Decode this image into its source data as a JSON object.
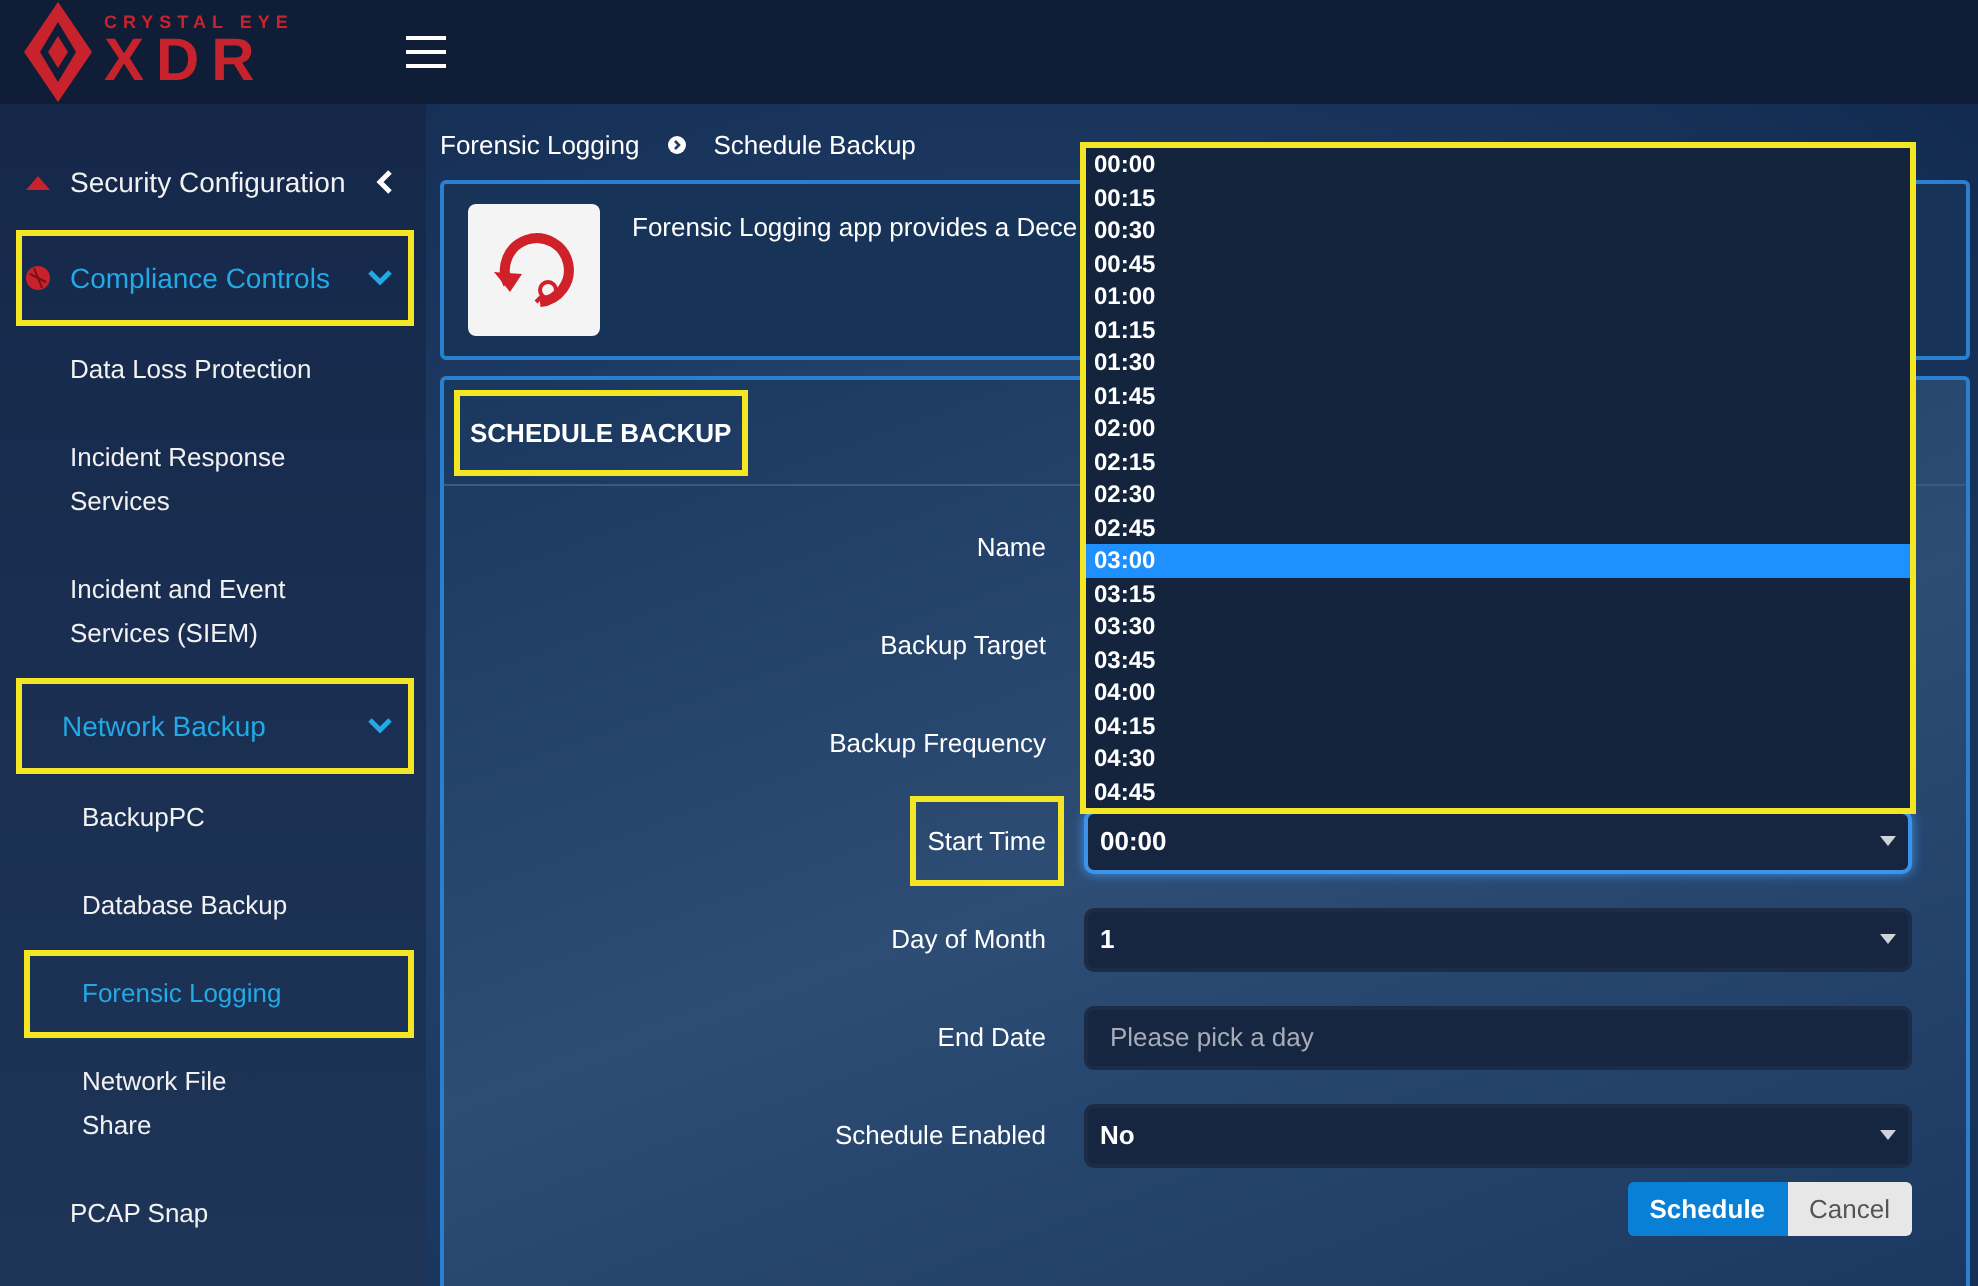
{
  "header": {
    "logo_tagline": "CRYSTAL EYE",
    "logo_text": "XDR"
  },
  "sidebar": {
    "items": [
      {
        "label": "Security Configuration",
        "kind": "section",
        "expanded": false,
        "selected": false,
        "highlighted": false
      },
      {
        "label": "Compliance Controls",
        "kind": "section",
        "expanded": true,
        "selected": true,
        "highlighted": true,
        "children": [
          {
            "label": "Data Loss Protection",
            "selected": false,
            "highlighted": false
          },
          {
            "label": "Incident Response\nServices",
            "selected": false,
            "highlighted": false
          },
          {
            "label": "Incident and Event\nServices (SIEM)",
            "selected": false,
            "highlighted": false
          },
          {
            "label": "Network Backup",
            "expanded": true,
            "selected": true,
            "highlighted": true,
            "children": [
              {
                "label": "BackupPC",
                "selected": false,
                "highlighted": false
              },
              {
                "label": "Database Backup",
                "selected": false,
                "highlighted": false
              },
              {
                "label": "Forensic Logging",
                "selected": true,
                "highlighted": true
              },
              {
                "label": "Network File\nShare",
                "selected": false,
                "highlighted": false
              }
            ]
          },
          {
            "label": "PCAP Snap",
            "selected": false,
            "highlighted": false
          }
        ]
      }
    ]
  },
  "breadcrumb": [
    "Forensic Logging",
    "Schedule Backup"
  ],
  "intro": {
    "text": "Forensic Logging app provides a Dece"
  },
  "form": {
    "title": "SCHEDULE BACKUP",
    "title_highlighted": true,
    "fields": [
      {
        "label": "Name",
        "kind": "covered",
        "highlighted": false
      },
      {
        "label": "Backup Target",
        "kind": "covered",
        "highlighted": false
      },
      {
        "label": "Backup Frequency",
        "kind": "covered",
        "highlighted": false
      },
      {
        "label": "Start Time",
        "kind": "select",
        "value": "00:00",
        "focused": true,
        "highlighted": true
      },
      {
        "label": "Day of Month",
        "kind": "select",
        "value": "1",
        "focused": false,
        "highlighted": false
      },
      {
        "label": "End Date",
        "kind": "text",
        "placeholder": "Please pick a day",
        "focused": false,
        "highlighted": false
      },
      {
        "label": "Schedule Enabled",
        "kind": "select",
        "value": "No",
        "focused": false,
        "highlighted": false
      }
    ],
    "buttons": [
      {
        "label": "Schedule",
        "kind": "primary"
      },
      {
        "label": "Cancel",
        "kind": "secondary"
      }
    ]
  },
  "dropdown": {
    "highlighted": true,
    "options": [
      {
        "label": "00:00",
        "selected": false
      },
      {
        "label": "00:15",
        "selected": false
      },
      {
        "label": "00:30",
        "selected": false
      },
      {
        "label": "00:45",
        "selected": false
      },
      {
        "label": "01:00",
        "selected": false
      },
      {
        "label": "01:15",
        "selected": false
      },
      {
        "label": "01:30",
        "selected": false
      },
      {
        "label": "01:45",
        "selected": false
      },
      {
        "label": "02:00",
        "selected": false
      },
      {
        "label": "02:15",
        "selected": false
      },
      {
        "label": "02:30",
        "selected": false
      },
      {
        "label": "02:45",
        "selected": false
      },
      {
        "label": "03:00",
        "selected": true
      },
      {
        "label": "03:15",
        "selected": false
      },
      {
        "label": "03:30",
        "selected": false
      },
      {
        "label": "03:45",
        "selected": false
      },
      {
        "label": "04:00",
        "selected": false
      },
      {
        "label": "04:15",
        "selected": false
      },
      {
        "label": "04:30",
        "selected": false
      },
      {
        "label": "04:45",
        "selected": false
      }
    ]
  }
}
